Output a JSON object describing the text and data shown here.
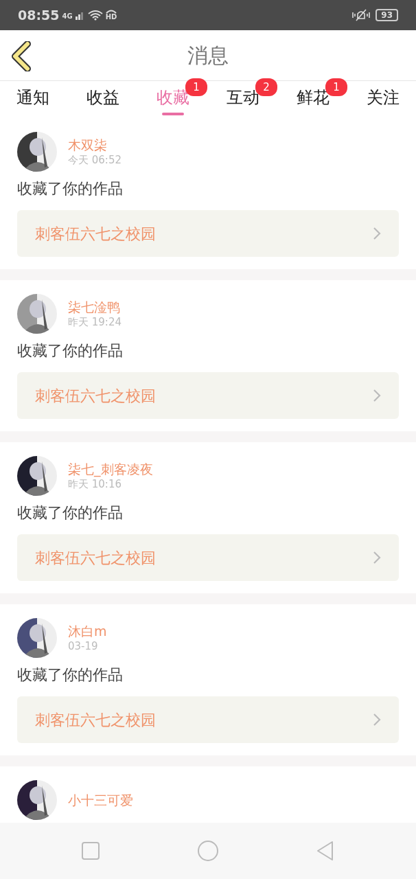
{
  "status_bar": {
    "time": "08:55",
    "network": "4G",
    "hd": "HD",
    "battery": "93"
  },
  "header": {
    "title": "消息"
  },
  "tabs": [
    {
      "label": "通知",
      "selected": false
    },
    {
      "label": "收益",
      "selected": false
    },
    {
      "label": "收藏",
      "selected": true,
      "badge": "1"
    },
    {
      "label": "互动",
      "selected": false,
      "badge": "2"
    },
    {
      "label": "鲜花",
      "selected": false,
      "badge": "1"
    },
    {
      "label": "关注",
      "selected": false
    }
  ],
  "messages": [
    {
      "user": "木双柒",
      "time": "今天 06:52",
      "text": "收藏了你的作品",
      "work": "刺客伍六七之校园"
    },
    {
      "user": "柒七淦鸭",
      "time": "昨天 19:24",
      "text": "收藏了你的作品",
      "work": "刺客伍六七之校园"
    },
    {
      "user": "柒七_刺客凌夜",
      "time": "昨天 10:16",
      "text": "收藏了你的作品",
      "work": "刺客伍六七之校园"
    },
    {
      "user": "沐白m",
      "time": "03-19",
      "text": "收藏了你的作品",
      "work": "刺客伍六七之校园"
    },
    {
      "user": "小十三可爱"
    }
  ]
}
